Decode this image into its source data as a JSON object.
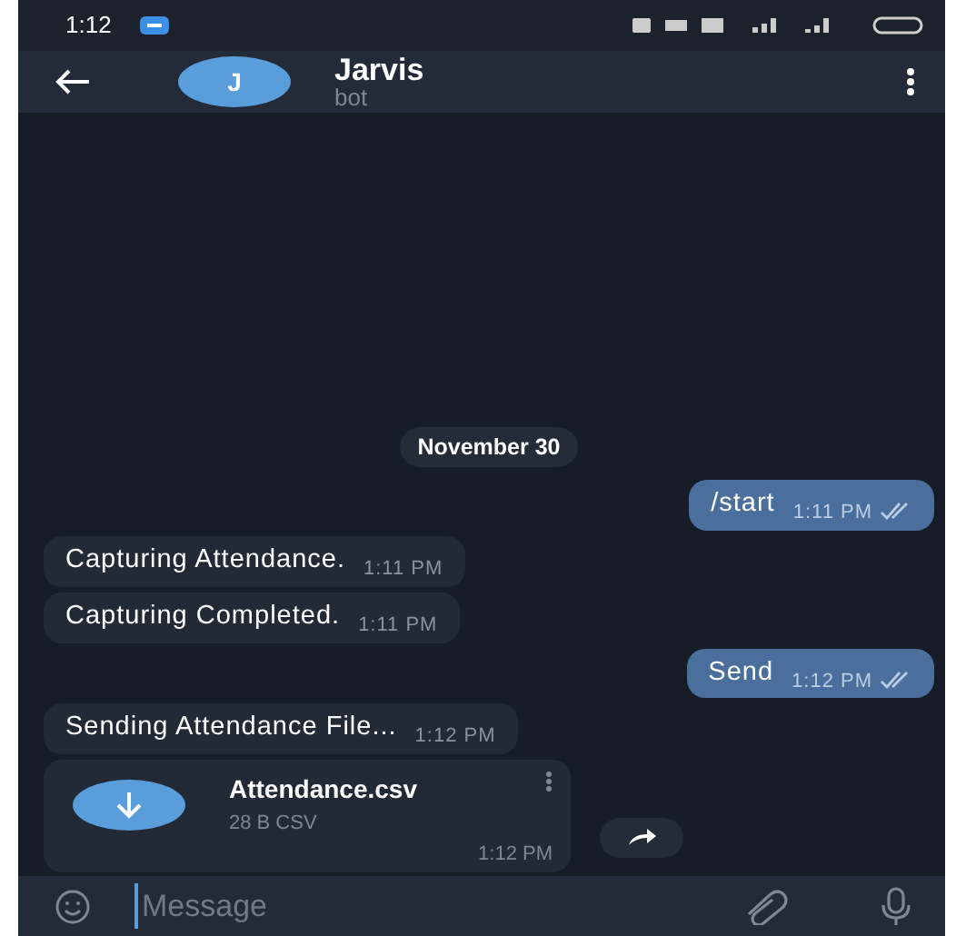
{
  "status_bar": {
    "time": "1:12"
  },
  "header": {
    "avatar_letter": "J",
    "title": "Jarvis",
    "subtitle": "bot"
  },
  "messages": [
    {
      "kind": "date",
      "text": "November 30"
    },
    {
      "kind": "outgoing",
      "text": "/start",
      "time": "1:11 PM",
      "read": true
    },
    {
      "kind": "incoming",
      "text": "Capturing Attendance.",
      "time": "1:11 PM"
    },
    {
      "kind": "incoming",
      "text": "Capturing Completed.",
      "time": "1:11 PM"
    },
    {
      "kind": "outgoing",
      "text": "Send",
      "time": "1:12 PM",
      "read": true
    },
    {
      "kind": "incoming",
      "text": "Sending Attendance File...",
      "time": "1:12 PM"
    },
    {
      "kind": "file",
      "name": "Attendance.csv",
      "meta": "28 B CSV",
      "time": "1:12 PM"
    }
  ],
  "composer": {
    "placeholder": "Message"
  }
}
